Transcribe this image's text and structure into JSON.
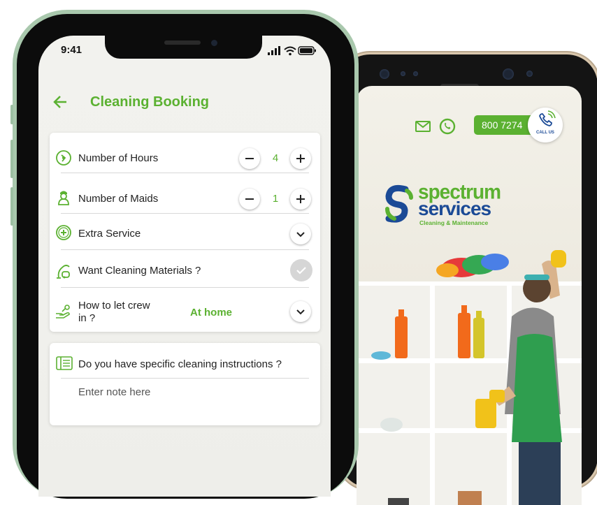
{
  "status_bar": {
    "time": "9:41"
  },
  "header": {
    "title": "Cleaning Booking"
  },
  "booking": {
    "hours": {
      "label": "Number of Hours",
      "value": "4"
    },
    "maids": {
      "label": "Number of Maids",
      "value": "1"
    },
    "extra": {
      "label": "Extra Service"
    },
    "materials": {
      "label": "Want Cleaning Materials ?"
    },
    "crew": {
      "label_line1": "How to let crew",
      "label_line2": "in ?",
      "value": "At home"
    }
  },
  "instructions": {
    "label": "Do you have specific cleaning instructions ?",
    "placeholder": "Enter note here"
  },
  "right_app": {
    "phone_number": "800 7274",
    "call_us": "CALL US",
    "logo_line1": "spectrum",
    "logo_line2": "services",
    "logo_tagline": "Cleaning & Maintenance"
  },
  "colors": {
    "accent": "#5bb131",
    "brand_blue": "#1b4a96"
  }
}
